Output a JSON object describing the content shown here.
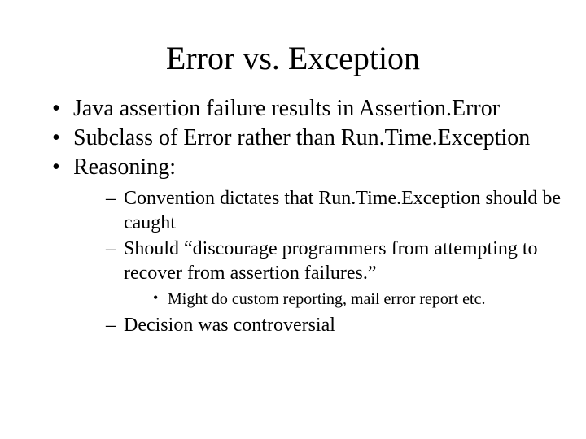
{
  "title": "Error vs. Exception",
  "bullets": [
    {
      "text": "Java assertion failure results in Assertion.Error"
    },
    {
      "text": "Subclass of Error rather than Run.Time.Exception"
    },
    {
      "text": "Reasoning:",
      "sub": [
        {
          "text": "Convention dictates that Run.Time.Exception should be caught"
        },
        {
          "text": "Should “discourage programmers from attempting to recover from assertion failures.”",
          "sub": [
            {
              "text": "Might do custom reporting, mail error report etc."
            }
          ]
        },
        {
          "text": "Decision was controversial"
        }
      ]
    }
  ]
}
